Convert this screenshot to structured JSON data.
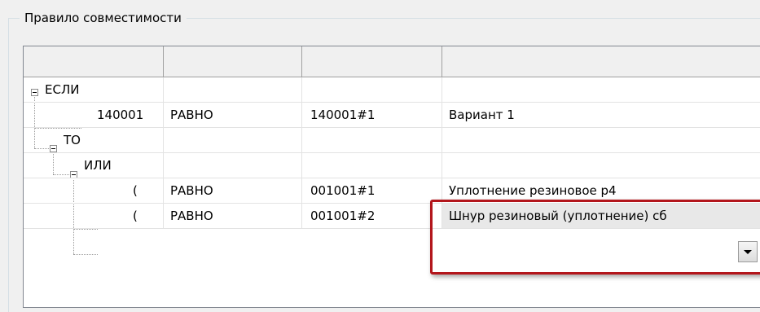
{
  "group": {
    "title": "Правило совместимости"
  },
  "grid": {
    "columns": [
      "",
      "",
      "",
      ""
    ],
    "rows": [
      {
        "tree": "ЕСЛИ",
        "op": "",
        "code": "",
        "value": ""
      },
      {
        "tree": "140001",
        "op": "РАВНО",
        "code": "140001#1",
        "value": "Вариант 1"
      },
      {
        "tree": "ТО",
        "op": "",
        "code": "",
        "value": ""
      },
      {
        "tree": "ИЛИ",
        "op": "",
        "code": "",
        "value": ""
      },
      {
        "tree": "(",
        "op": "РАВНО",
        "code": "001001#1",
        "value": "Уплотнение резиновое р4"
      },
      {
        "tree": "(",
        "op": "РАВНО",
        "code": "001001#2",
        "value": "Шнур резиновый (уплотнение) сб"
      }
    ]
  },
  "icons": {
    "expander": "tree-expander-minus",
    "dropdown": "chevron-down-icon"
  },
  "colors": {
    "highlight": "#b3161c"
  }
}
